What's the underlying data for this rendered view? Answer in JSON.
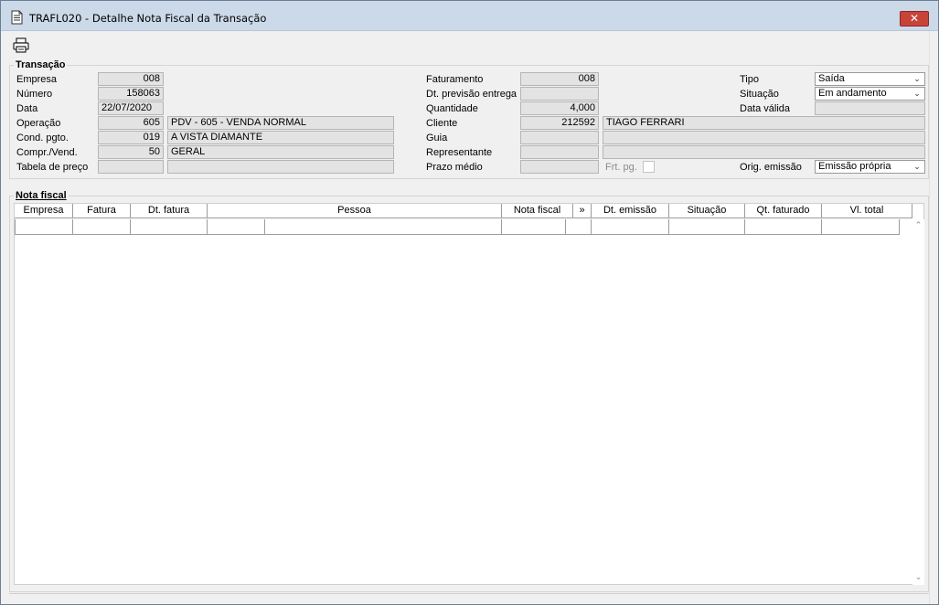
{
  "window": {
    "title": "TRAFL020 - Detalhe Nota Fiscal da Transação",
    "close_label": "✕"
  },
  "toolbar": {
    "print_icon": "printer-icon"
  },
  "transacao": {
    "legend": "Transação",
    "empresa_label": "Empresa",
    "empresa": "008",
    "numero_label": "Número",
    "numero": "158063",
    "data_label": "Data",
    "data": "22/07/2020",
    "operacao_label": "Operação",
    "operacao_codigo": "605",
    "operacao_desc": "PDV - 605 - VENDA NORMAL",
    "cond_label": "Cond. pgto.",
    "cond_codigo": "019",
    "cond_desc": "A VISTA DIAMANTE",
    "compr_label": "Compr./Vend.",
    "compr_codigo": "50",
    "compr_desc": "GERAL",
    "tabela_label": "Tabela de preço",
    "tabela_codigo": "",
    "tabela_desc": "",
    "faturamento_label": "Faturamento",
    "faturamento": "008",
    "dtprev_label": "Dt. previsão entrega",
    "dtprev": "",
    "quantidade_label": "Quantidade",
    "quantidade": "4,000",
    "cliente_label": "Cliente",
    "cliente_codigo": "212592",
    "cliente_nome": "TIAGO FERRARI",
    "guia_label": "Guia",
    "guia_codigo": "",
    "guia_desc": "",
    "representante_label": "Representante",
    "representante_codigo": "",
    "representante_desc": "",
    "prazo_label": "Prazo médio",
    "prazo": "",
    "frt_label": "Frt. pg.",
    "tipo_label": "Tipo",
    "tipo": "Saída",
    "situacao_label": "Situação",
    "situacao": "Em andamento",
    "datavalida_label": "Data válida",
    "datavalida": "",
    "origem_label": "Orig. emissão",
    "origem": "Emissão própria"
  },
  "nota_fiscal": {
    "legend": "Nota fiscal",
    "columns": [
      "Empresa",
      "Fatura",
      "Dt. fatura",
      "Pessoa",
      "Nota fiscal",
      "»",
      "Dt. emissão",
      "Situação",
      "Qt. faturado",
      "Vl. total"
    ]
  }
}
